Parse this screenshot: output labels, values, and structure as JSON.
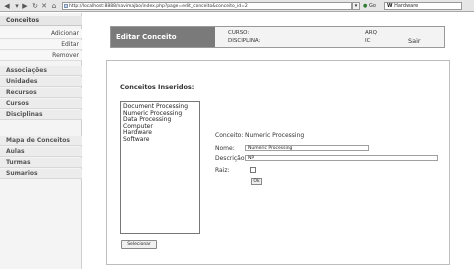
{
  "browser": {
    "back_icon": "back-arrow-icon",
    "forward_icon": "forward-arrow-icon",
    "url": "http://localhost:8888/navimajbo/index.php?page=edit_conceito&conceito_id=2",
    "go_label": "Go",
    "search_logo": "W",
    "search_text": "Hardware"
  },
  "sidebar": {
    "conceitos": "Conceitos",
    "adicionar": "Adicionar",
    "editar": "Editar",
    "remover": "Remover",
    "items": [
      "Associações",
      "Unidades",
      "Recursos",
      "Cursos",
      "Disciplinas"
    ],
    "mapa": "Mapa de Conceitos",
    "items2": [
      "Aulas",
      "Turmas",
      "Sumarios"
    ]
  },
  "header": {
    "title": "Editar Conceito",
    "curso_label": "CURSO:",
    "curso_value": "ARQ",
    "disciplina_label": "DISCIPLINA:",
    "disciplina_value": "IC",
    "sair": "Sair"
  },
  "main": {
    "section_title": "Conceitos Inseridos:",
    "list": [
      "Document Processing",
      "Numeric Processing",
      "Data Processing",
      "Computer",
      "Hardware",
      "Software"
    ],
    "select_button": "Selecionar",
    "conceito_label": "Conceito:",
    "conceito_value": "Numeric Processing",
    "nome_label": "Nome:",
    "nome_value": "Numeric Processing",
    "descricao_label": "Descrição:",
    "descricao_value": "NP",
    "raiz_label": "Raiz:",
    "ok_button": "Ok"
  }
}
